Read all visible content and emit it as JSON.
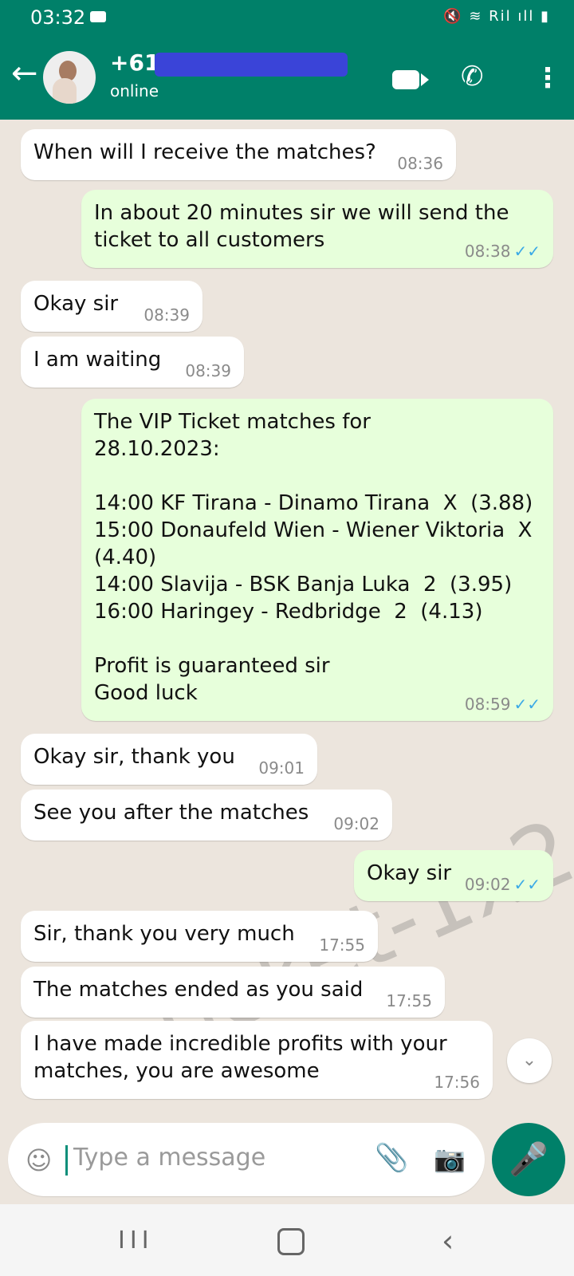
{
  "status_bar": {
    "time": "03:32",
    "system_icons": "🔇 ≋ Ril ıll ▮"
  },
  "header": {
    "back_icon": "back-arrow-icon",
    "contact_name": "+61",
    "status": "online",
    "video_icon": "video-camera-icon",
    "call_icon": "phone-icon",
    "menu_icon": "more-vertical-icon",
    "accent": "#008069"
  },
  "chat": {
    "messages": [
      {
        "dir": "in",
        "text": "When will I receive the matches?",
        "time": "08:36"
      },
      {
        "dir": "out",
        "text": "In about 20 minutes sir we will send the\nticket to all customers",
        "time": "08:38"
      },
      {
        "dir": "in",
        "text": "Okay sir",
        "time": "08:39"
      },
      {
        "dir": "in",
        "text": "I am waiting",
        "time": "08:39"
      },
      {
        "dir": "out",
        "text": "The VIP Ticket matches for\n28.10.2023:\n\n14:00 KF Tirana - Dinamo Tirana  X  (3.88)\n15:00 Donaufeld Wien - Wiener Viktoria  X\n(4.40)\n14:00 Slavija - BSK Banja Luka  2  (3.95)\n16:00 Haringey - Redbridge  2  (4.13)\n\nProfit is guaranteed sir\nGood luck",
        "time": "08:59"
      },
      {
        "dir": "in",
        "text": "Okay sir, thank you",
        "time": "09:01"
      },
      {
        "dir": "in",
        "text": "See you after the matches",
        "time": "09:02"
      },
      {
        "dir": "out",
        "text": "Okay sir",
        "time": "09:02"
      },
      {
        "dir": "in",
        "text": "Sir, thank you very much",
        "time": "17:55"
      },
      {
        "dir": "in",
        "text": "The matches ended as you said",
        "time": "17:55"
      },
      {
        "dir": "in",
        "text": "I have made incredible profits with your\nmatches, you are awesome",
        "time": "17:56"
      }
    ],
    "watermark": "Ticket-1x2",
    "read_ticks": "✓✓"
  },
  "composer": {
    "placeholder": "Type a message",
    "emoji_icon": "smiley-icon",
    "attach_icon": "paperclip-icon",
    "camera_icon": "camera-icon",
    "mic_icon": "microphone-icon"
  },
  "navigation": {
    "recent_icon": "recent-apps-icon",
    "home_icon": "home-icon",
    "back_icon": "back-icon"
  }
}
